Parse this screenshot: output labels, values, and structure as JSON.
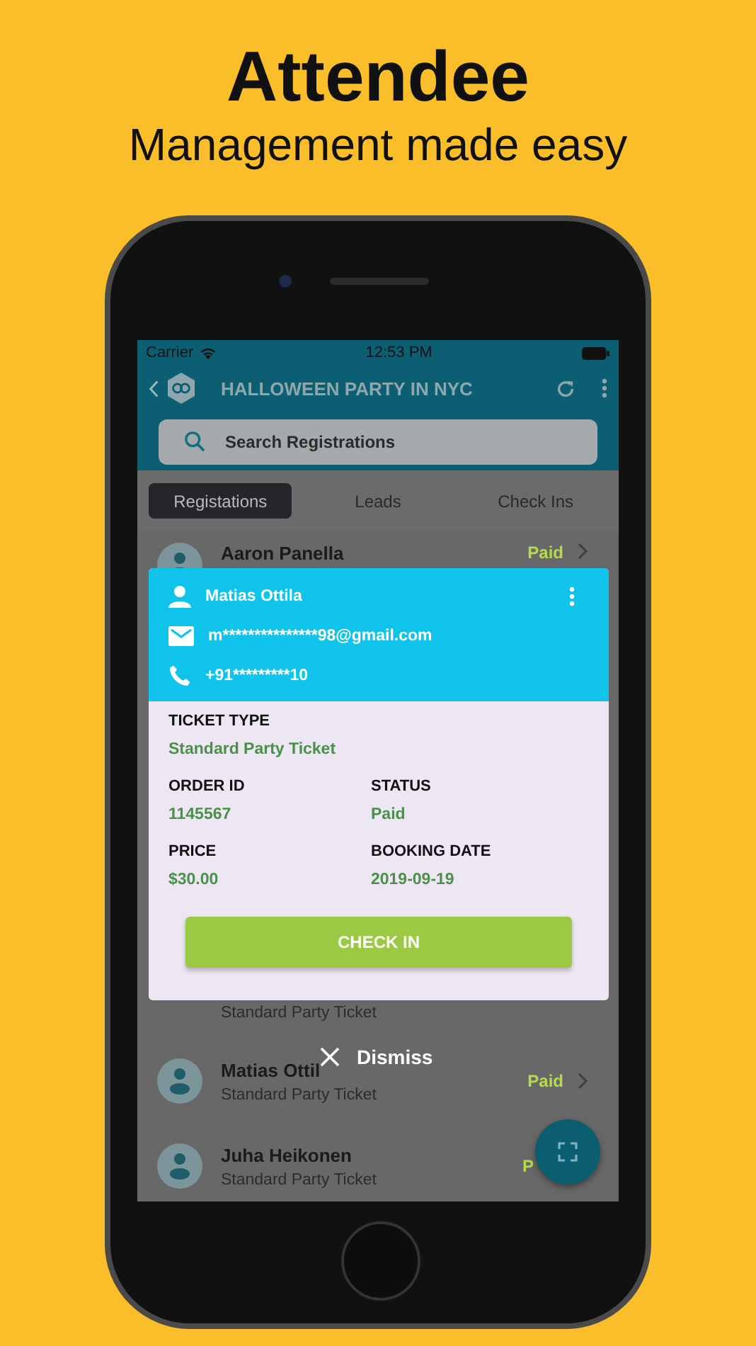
{
  "headline": {
    "title": "Attendee",
    "subtitle": "Management made easy"
  },
  "status_bar": {
    "carrier": "Carrier",
    "time": "12:53 PM"
  },
  "app_bar": {
    "title": "HALLOWEEN PARTY IN NYC"
  },
  "search": {
    "placeholder": "Search Registrations"
  },
  "tabs": [
    {
      "label": "Registations",
      "selected": true
    },
    {
      "label": "Leads",
      "selected": false
    },
    {
      "label": "Check Ins",
      "selected": false
    }
  ],
  "registrations": [
    {
      "name": "Aaron Panella",
      "status": "Paid"
    },
    {
      "ticket": "Standard Party Ticket"
    },
    {
      "name": "Matias Ottil",
      "ticket": "Standard Party Ticket",
      "status": "Paid"
    },
    {
      "name": "Juha Heikonen",
      "ticket": "Standard Party Ticket",
      "status": "P"
    }
  ],
  "dialog": {
    "name": "Matias Ottila",
    "email": "m***************98@gmail.com",
    "phone": "+91*********10",
    "fields": [
      {
        "label": "TICKET TYPE",
        "value": "Standard Party Ticket"
      },
      {
        "label": "ORDER ID",
        "value": "1145567"
      },
      {
        "label": "STATUS",
        "value": "Paid"
      },
      {
        "label": "PRICE",
        "value": "$30.00"
      },
      {
        "label": "BOOKING DATE",
        "value": "2019-09-19"
      }
    ],
    "button": "CHECK IN"
  },
  "dismiss": {
    "label": "Dismiss"
  }
}
